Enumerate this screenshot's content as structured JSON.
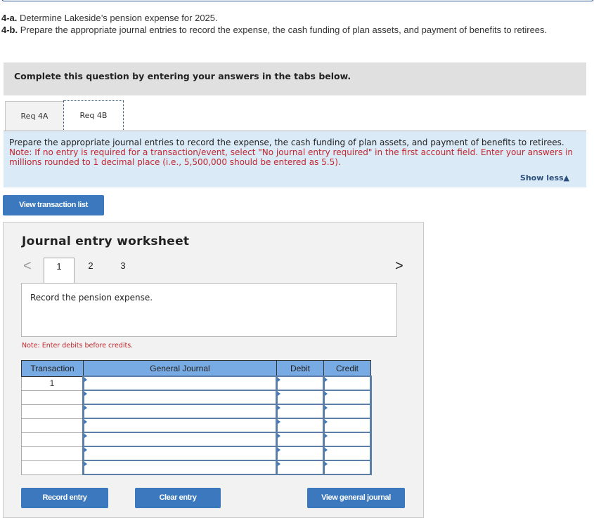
{
  "question": {
    "part_a_label": "4-a.",
    "part_a_text": " Determine Lakeside’s pension expense for 2025.",
    "part_b_label": "4-b.",
    "part_b_text": " Prepare the appropriate journal entries to record the expense, the cash funding of plan assets, and payment of benefits to retirees."
  },
  "banner": "Complete this question by entering your answers in the tabs below.",
  "tabs": [
    {
      "label": "Req 4A",
      "active": false
    },
    {
      "label": "Req 4B",
      "active": true
    }
  ],
  "instructions": {
    "main": "Prepare the appropriate journal entries to record the expense, the cash funding of plan assets, and payment of benefits to retirees.",
    "note": "Note: If no entry is required for a transaction/event, select \"No journal entry required\" in the first account field. Enter your answers in millions rounded to 1 decimal place (i.e., 5,500,000 should be entered as 5.5).",
    "show_less": "Show less▲"
  },
  "view_transaction_list": "View transaction list",
  "worksheet": {
    "title": "Journal entry worksheet",
    "prev": "<",
    "next": ">",
    "pages": [
      "1",
      "2",
      "3"
    ],
    "current_page": "1",
    "description": "Record the pension expense.",
    "note": "Note: Enter debits before credits.",
    "columns": [
      "Transaction",
      "General Journal",
      "Debit",
      "Credit"
    ],
    "rows": [
      {
        "transaction": "1",
        "account": "",
        "debit": "",
        "credit": ""
      },
      {
        "transaction": "",
        "account": "",
        "debit": "",
        "credit": ""
      },
      {
        "transaction": "",
        "account": "",
        "debit": "",
        "credit": ""
      },
      {
        "transaction": "",
        "account": "",
        "debit": "",
        "credit": ""
      },
      {
        "transaction": "",
        "account": "",
        "debit": "",
        "credit": ""
      },
      {
        "transaction": "",
        "account": "",
        "debit": "",
        "credit": ""
      },
      {
        "transaction": "",
        "account": "",
        "debit": "",
        "credit": ""
      }
    ],
    "buttons": {
      "record": "Record entry",
      "clear": "Clear entry",
      "view_journal": "View general journal"
    }
  }
}
